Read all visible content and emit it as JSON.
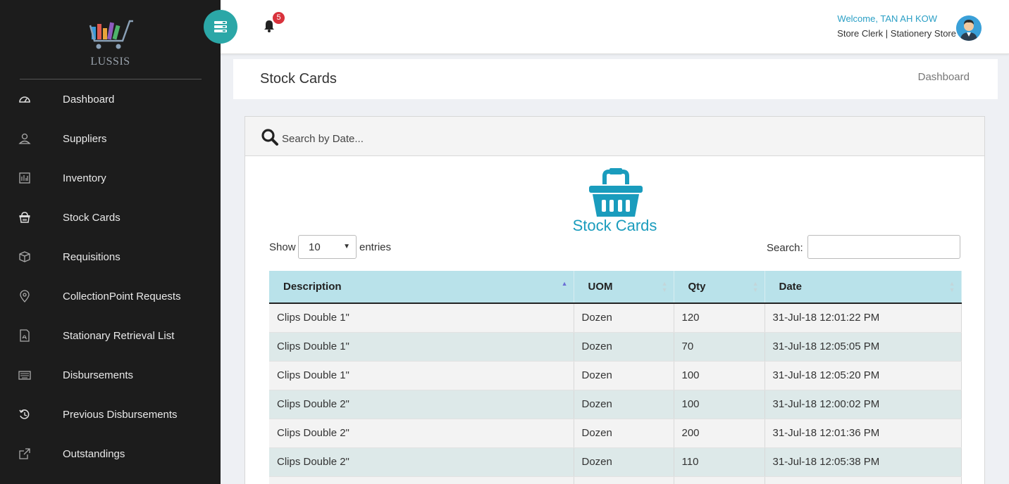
{
  "app": {
    "name": "LUSSIS"
  },
  "sidebar": {
    "items": [
      {
        "label": "Dashboard",
        "icon": "dashboard-icon"
      },
      {
        "label": "Suppliers",
        "icon": "user-icon"
      },
      {
        "label": "Inventory",
        "icon": "inventory-icon"
      },
      {
        "label": "Stock Cards",
        "icon": "basket-icon"
      },
      {
        "label": "Requisitions",
        "icon": "box-icon"
      },
      {
        "label": "CollectionPoint Requests",
        "icon": "map-pin-icon"
      },
      {
        "label": "Stationary Retrieval List",
        "icon": "pdf-file-icon"
      },
      {
        "label": "Disbursements",
        "icon": "keyboard-icon"
      },
      {
        "label": "Previous Disbursements",
        "icon": "history-icon"
      },
      {
        "label": "Outstandings",
        "icon": "external-link-icon"
      }
    ]
  },
  "topbar": {
    "notification_count": "5",
    "welcome": "Welcome, TAN AH KOW",
    "role": "Store Clerk | Stationery Store"
  },
  "page": {
    "title": "Stock Cards",
    "breadcrumb": "Dashboard"
  },
  "card": {
    "search_date_placeholder": "Search by Date...",
    "heading": "Stock Cards",
    "show_label": "Show",
    "page_size": "10",
    "entries_label": "entries",
    "search_label": "Search:",
    "search_value": ""
  },
  "table": {
    "columns": [
      "Description",
      "UOM",
      "Qty",
      "Date"
    ],
    "rows": [
      [
        "Clips Double 1\"",
        "Dozen",
        "120",
        "31-Jul-18 12:01:22 PM"
      ],
      [
        "Clips Double 1\"",
        "Dozen",
        "70",
        "31-Jul-18 12:05:05 PM"
      ],
      [
        "Clips Double 1\"",
        "Dozen",
        "100",
        "31-Jul-18 12:05:20 PM"
      ],
      [
        "Clips Double 2\"",
        "Dozen",
        "100",
        "31-Jul-18 12:00:02 PM"
      ],
      [
        "Clips Double 2\"",
        "Dozen",
        "200",
        "31-Jul-18 12:01:36 PM"
      ],
      [
        "Clips Double 2\"",
        "Dozen",
        "110",
        "31-Jul-18 12:05:38 PM"
      ]
    ]
  },
  "colors": {
    "sidebar_bg": "#1c1c1c",
    "accent_teal": "#2ba7a7",
    "header_row_bg": "#b9e2ea",
    "title_blue": "#1a9cbd",
    "badge_red": "#d9323c"
  }
}
